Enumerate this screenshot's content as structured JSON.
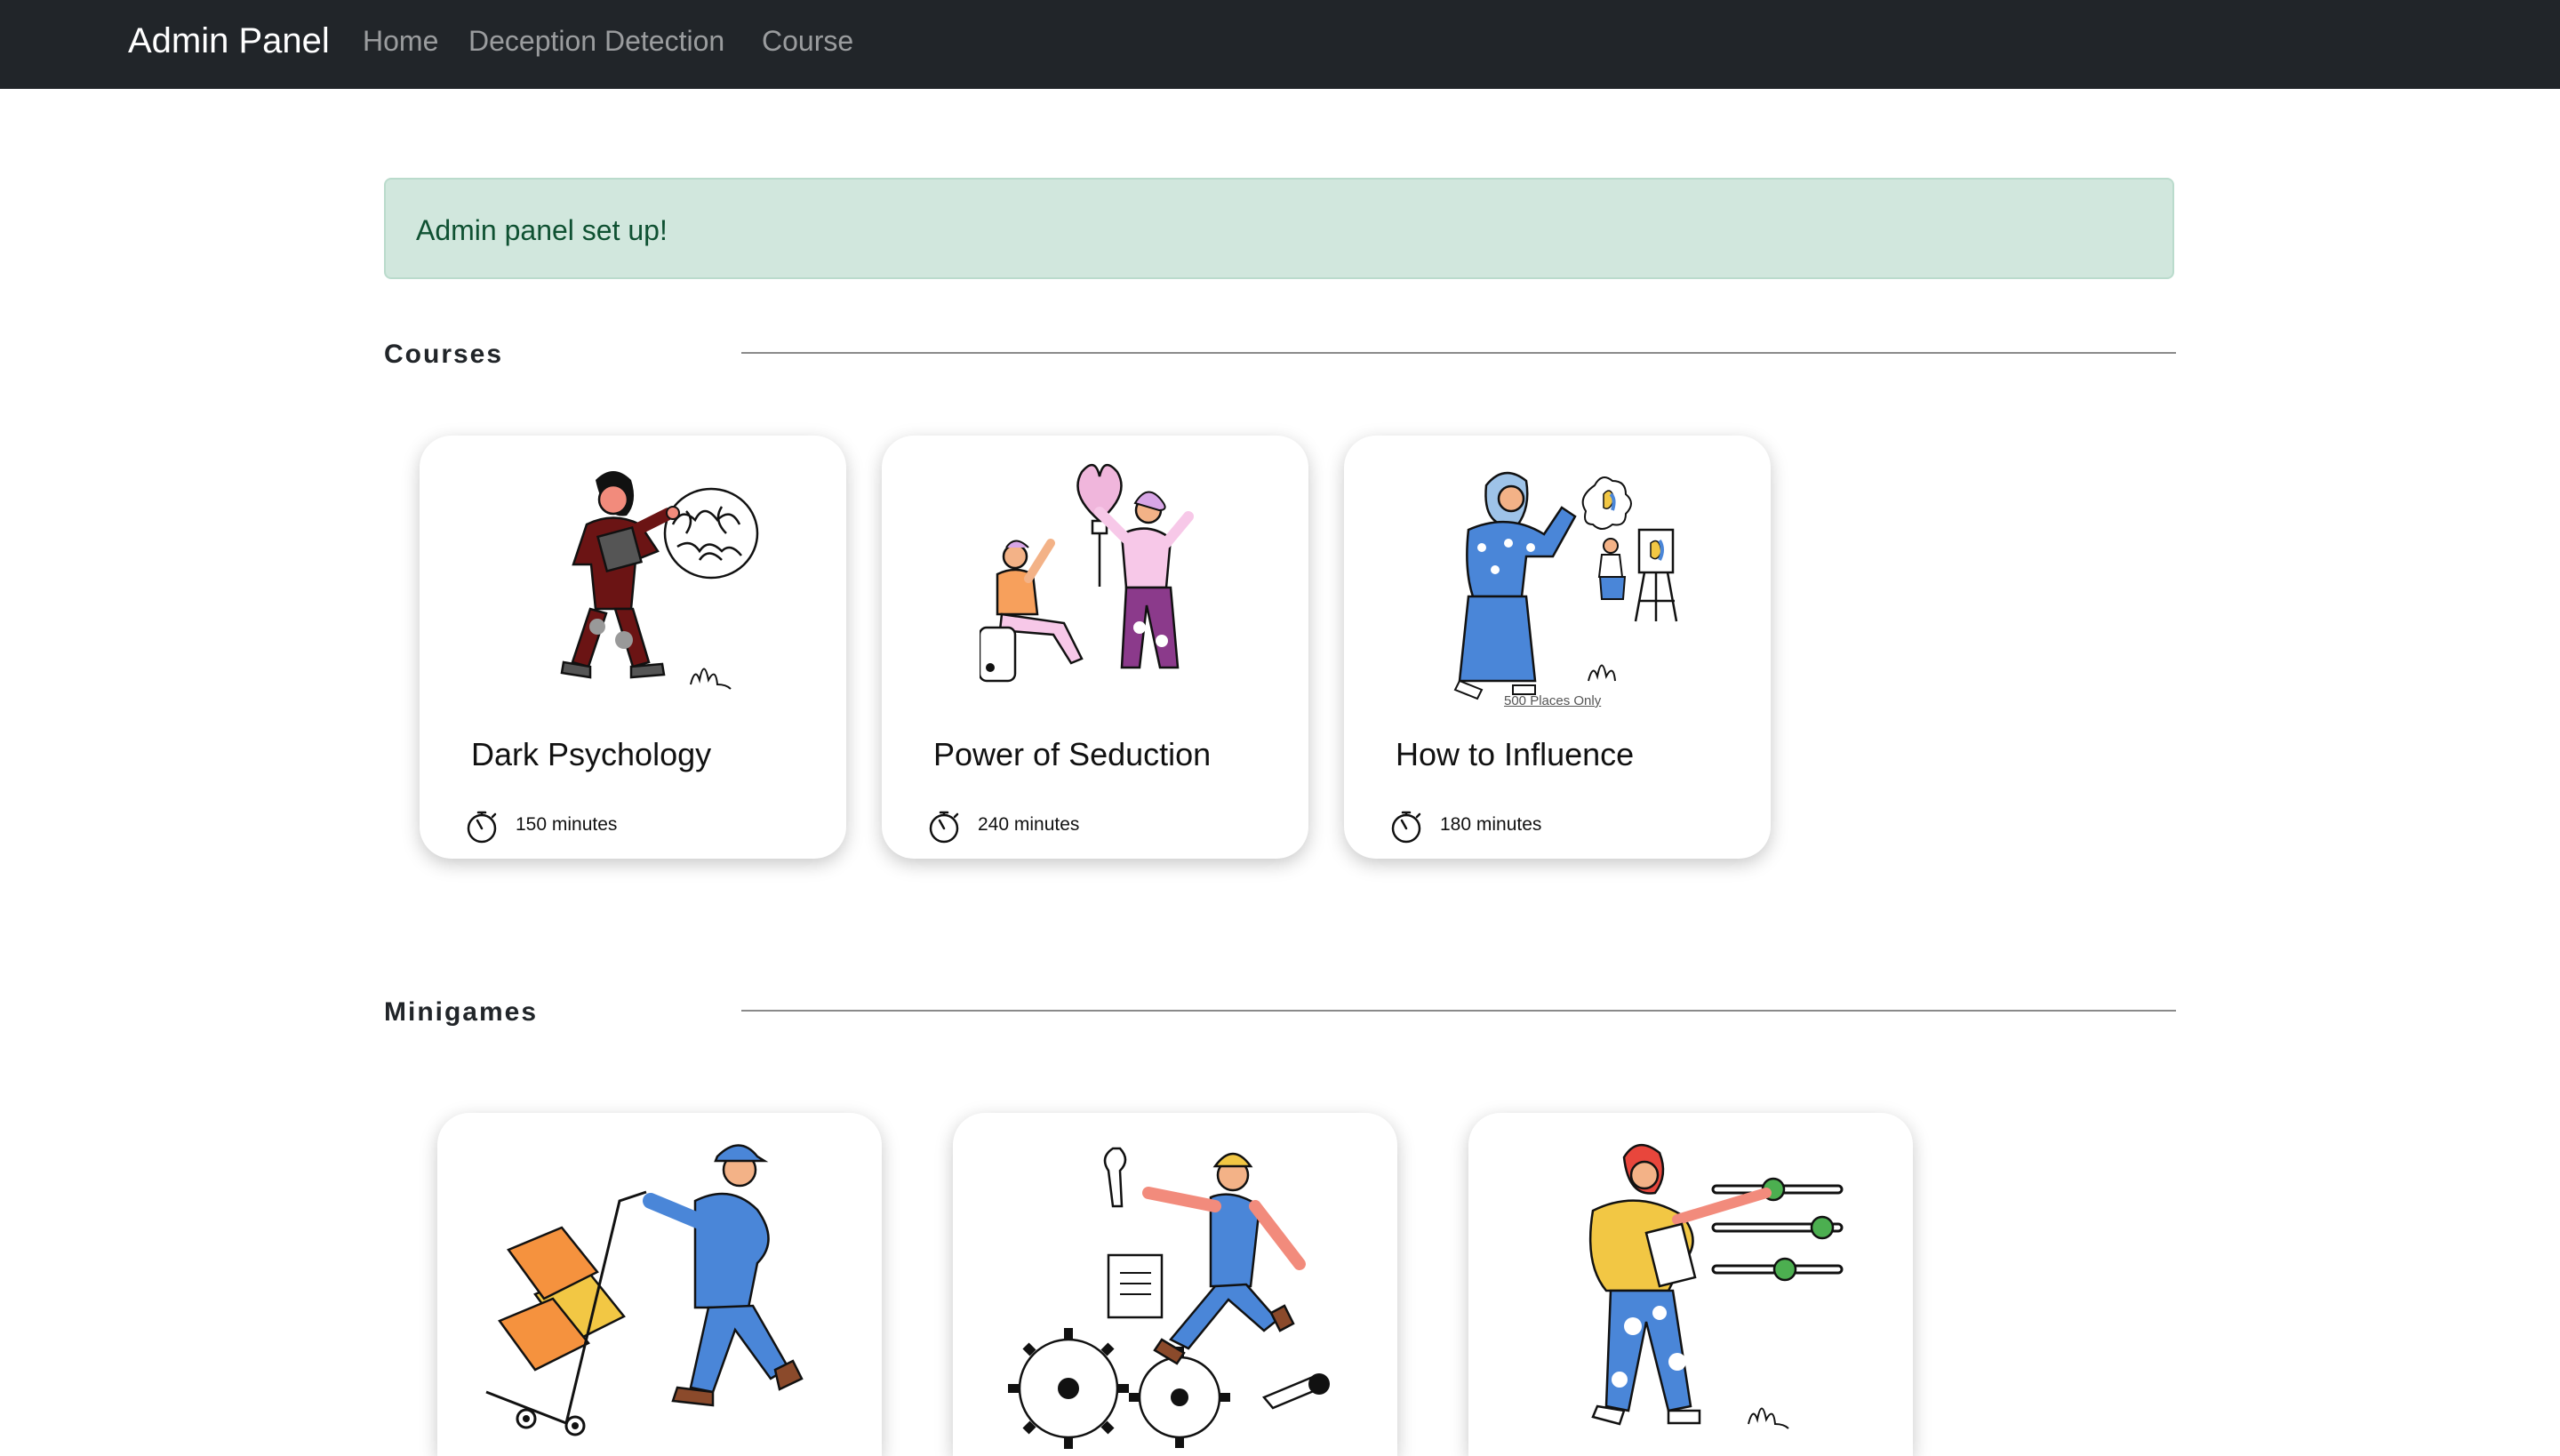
{
  "nav": {
    "brand": "Admin Panel",
    "links": [
      "Home",
      "Deception Detection",
      "Course"
    ]
  },
  "alert": {
    "message": "Admin panel set up!"
  },
  "courses": {
    "heading": "Courses",
    "items": [
      {
        "title": "Dark Psychology",
        "duration": "150 minutes",
        "illustration": "woman-holding-brain"
      },
      {
        "title": "Power of Seduction",
        "duration": "240 minutes",
        "illustration": "couple-with-lightbulb-heart"
      },
      {
        "title": "How to Influence",
        "duration": "180 minutes",
        "illustration": "woman-with-easel-painting",
        "caption": "500 Places Only"
      }
    ]
  },
  "minigames": {
    "heading": "Minigames",
    "items": [
      {
        "illustration": "delivery-man-with-hand-truck"
      },
      {
        "illustration": "mechanic-with-gears"
      },
      {
        "illustration": "woman-adjusting-sliders"
      }
    ]
  },
  "colors": {
    "navbar": "#212529",
    "alert_bg": "#d1e7dd",
    "alert_text": "#0f5132"
  }
}
